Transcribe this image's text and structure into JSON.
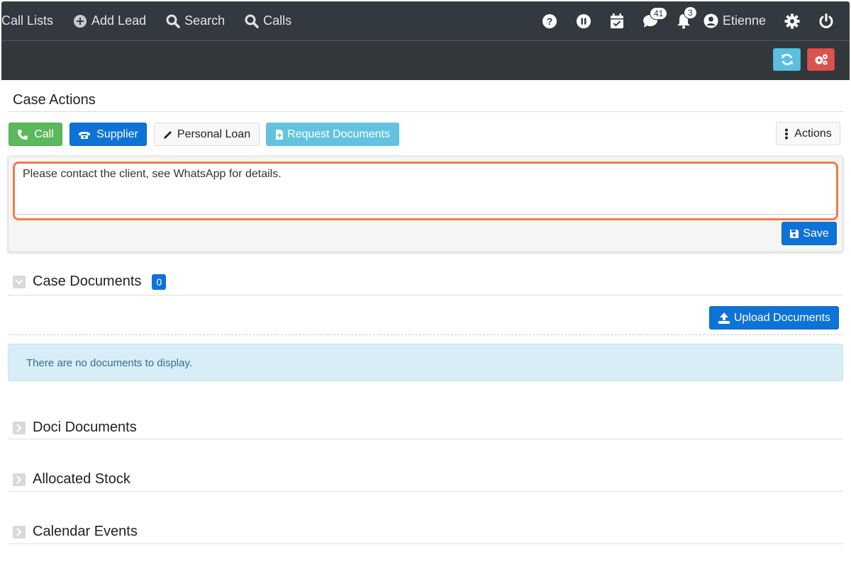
{
  "topnav": {
    "items": [
      {
        "label": "Call Lists",
        "icon": "list-icon"
      },
      {
        "label": "Add Lead",
        "icon": "plus-circle-icon"
      },
      {
        "label": "Search",
        "icon": "search-icon"
      },
      {
        "label": "Calls",
        "icon": "search-icon"
      }
    ],
    "messages_count": "41",
    "notifications_count": "3",
    "user_name": "Etienne"
  },
  "case_actions": {
    "title": "Case Actions",
    "buttons": {
      "call": "Call",
      "supplier": "Supplier",
      "personal_loan": "Personal Loan",
      "request_documents": "Request Documents",
      "actions": "Actions"
    },
    "note_text": "Please contact the client, see WhatsApp for details.",
    "save_label": "Save"
  },
  "case_documents": {
    "title": "Case Documents",
    "count": "0",
    "upload_label": "Upload Documents",
    "empty_message": "There are no documents to display."
  },
  "sections": {
    "doci_documents": "Doci Documents",
    "allocated_stock": "Allocated Stock",
    "calendar_events": "Calendar Events"
  },
  "colors": {
    "navbar": "#333a3f",
    "primary": "#0d73d7",
    "success": "#5cb85c",
    "info": "#5bc0de",
    "danger": "#d9534f",
    "highlight": "#f07c4a"
  }
}
